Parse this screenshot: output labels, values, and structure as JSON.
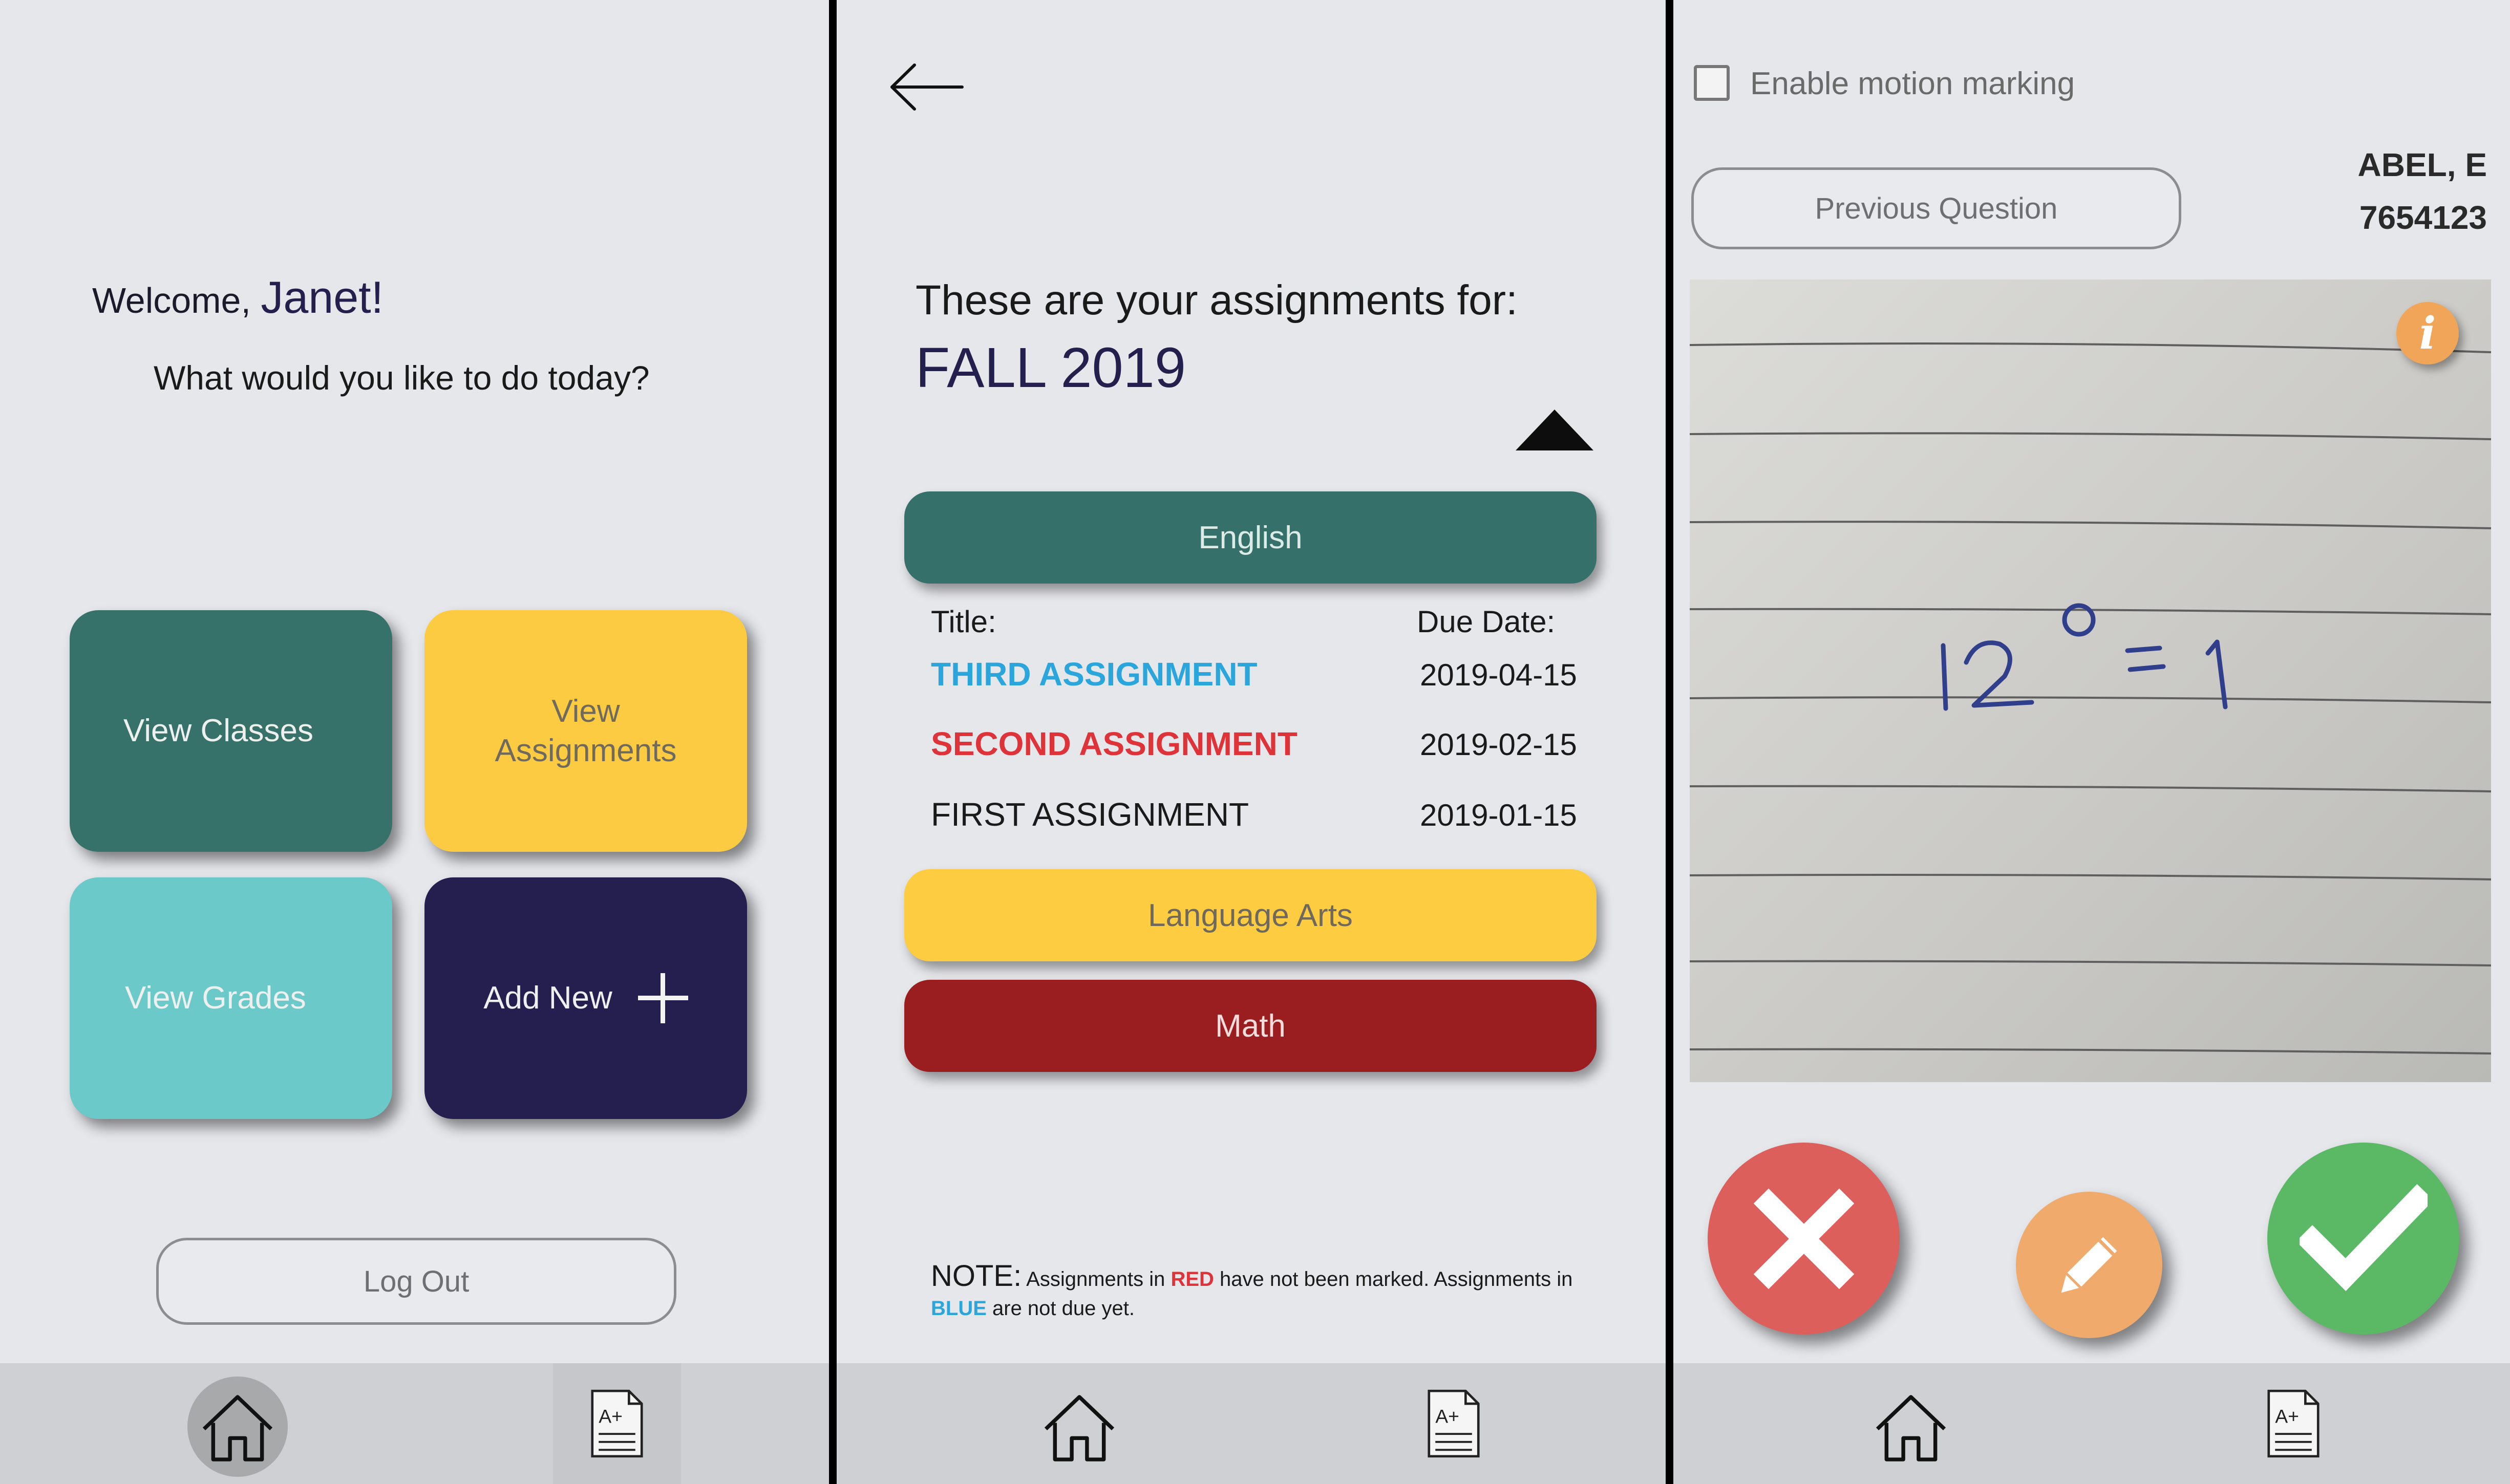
{
  "home": {
    "welcome_prefix": "Welcome, ",
    "user_name": "Janet!",
    "prompt": "What would you like to do today?",
    "tiles": {
      "view_classes": "View Classes",
      "view_assignments_line1": "View",
      "view_assignments_line2": "Assignments",
      "view_grades": "View Grades",
      "add_new": "Add New"
    },
    "logout_label": "Log Out"
  },
  "assignments": {
    "heading": "These are your assignments for:",
    "term": "FALL 2019",
    "classes": {
      "english": "English",
      "language_arts": "Language Arts",
      "math": "Math"
    },
    "columns": {
      "title": "Title:",
      "due": "Due Date:"
    },
    "rows": [
      {
        "title": "THIRD ASSIGNMENT",
        "due": "2019-04-15",
        "status": "blue"
      },
      {
        "title": "SECOND ASSIGNMENT",
        "due": "2019-02-15",
        "status": "red"
      },
      {
        "title": "FIRST ASSIGNMENT",
        "due": "2019-01-15",
        "status": "plain"
      }
    ],
    "note": {
      "lead": "NOTE:",
      "part1": "Assignments in ",
      "red_word": "RED",
      "part2": " have not been marked. Assignments in ",
      "blue_word": "BLUE",
      "part3": " are not due yet."
    }
  },
  "marking": {
    "motion_label": "Enable motion marking",
    "motion_enabled": false,
    "previous_label": "Previous Question",
    "student_name": "ABEL, E",
    "student_id": "7654123",
    "info_glyph": "i"
  },
  "nav": {
    "home_icon": "home-icon",
    "grades_icon": "grade-document-icon",
    "grade_text": "A+"
  },
  "colors": {
    "teal": "#36726a",
    "yellow": "#fdcb42",
    "light_teal": "#6cc9c9",
    "navy": "#241f4e",
    "maroon": "#9a1d20",
    "reject": "#dd5f5c",
    "edit": "#f0aa6c",
    "accept": "#5bb966",
    "info": "#f0a558"
  }
}
